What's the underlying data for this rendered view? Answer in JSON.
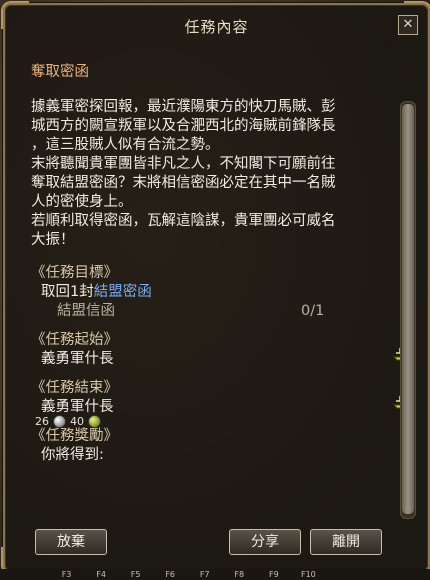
{
  "window": {
    "title": "任務內容",
    "close_glyph": "✕"
  },
  "quest": {
    "name": "奪取密函",
    "description": [
      "據義軍密探回報，最近濮陽東方的快刀馬賊、彭",
      "城西方的闕宣叛軍以及合淝西北的海賊前鋒隊長",
      "，這三股賊人似有合流之勢。",
      "末將聽聞貴軍團皆非凡之人，不知閣下可願前往",
      "奪取結盟密函？末將相信密函必定在其中一名賊",
      "人的密使身上。",
      "若順利取得密函，瓦解這陰謀，貴軍團必可威名",
      "大振！"
    ]
  },
  "objective": {
    "heading": "《任務目標》",
    "task_prefix": "取回1封",
    "task_link": "結盟密函",
    "item_name": "結盟信函",
    "progress": "0/1"
  },
  "start": {
    "heading": "《任務起始》",
    "npc": "義勇軍什長"
  },
  "end": {
    "heading": "《任務結束》",
    "npc": "義勇軍什長"
  },
  "reward": {
    "heading": "《任務獎勵》",
    "label": "你將得到:",
    "silver": "26",
    "copper": "40"
  },
  "buttons": {
    "abandon": "放棄",
    "share": "分享",
    "leave": "離開"
  },
  "hotkeys": [
    "F3",
    "F4",
    "F5",
    "F6",
    "F7",
    "F8",
    "F9",
    "F10"
  ]
}
